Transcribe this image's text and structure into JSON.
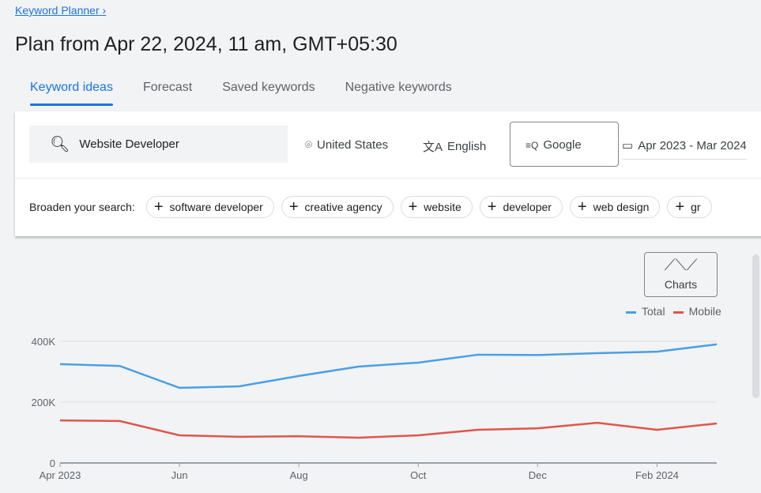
{
  "breadcrumb": "Keyword Planner",
  "page_title": "Plan from Apr 22, 2024, 11 am, GMT+05:30",
  "tabs": [
    {
      "label": "Keyword ideas",
      "active": true
    },
    {
      "label": "Forecast"
    },
    {
      "label": "Saved keywords"
    },
    {
      "label": "Negative keywords"
    }
  ],
  "search": {
    "value": "Website Developer"
  },
  "filters": {
    "location": "United States",
    "language": "English",
    "network": "Google",
    "date_range": "Apr 2023 - Mar 2024"
  },
  "broaden": {
    "label": "Broaden your search:",
    "chips": [
      "software developer",
      "creative agency",
      "website",
      "developer",
      "web design",
      "gr"
    ]
  },
  "charts_button": "Charts",
  "colors": {
    "accent": "#1a73e8",
    "total": "#4a9fe5",
    "mobile": "#e0554b"
  },
  "chart_data": {
    "type": "line",
    "x": [
      "Apr 2023",
      "May 2023",
      "Jun 2023",
      "Jul 2023",
      "Aug 2023",
      "Sep 2023",
      "Oct 2023",
      "Nov 2023",
      "Dec 2023",
      "Jan 2024",
      "Feb 2024",
      "Mar 2024"
    ],
    "x_tick_labels": [
      "Apr 2023",
      "Jun",
      "Aug",
      "Oct",
      "Dec",
      "Feb 2024"
    ],
    "y_tick_labels": [
      "0",
      "200K",
      "400K"
    ],
    "ylim": [
      0,
      400000
    ],
    "grid": true,
    "legend": "top-right",
    "series": [
      {
        "name": "Total",
        "values": [
          325000,
          319000,
          247000,
          252000,
          286000,
          317000,
          330000,
          356000,
          355000,
          361000,
          366000,
          390000
        ]
      },
      {
        "name": "Mobile",
        "values": [
          140000,
          138000,
          91000,
          86000,
          88000,
          83000,
          91000,
          109000,
          114000,
          132000,
          109000,
          130000
        ]
      }
    ]
  }
}
